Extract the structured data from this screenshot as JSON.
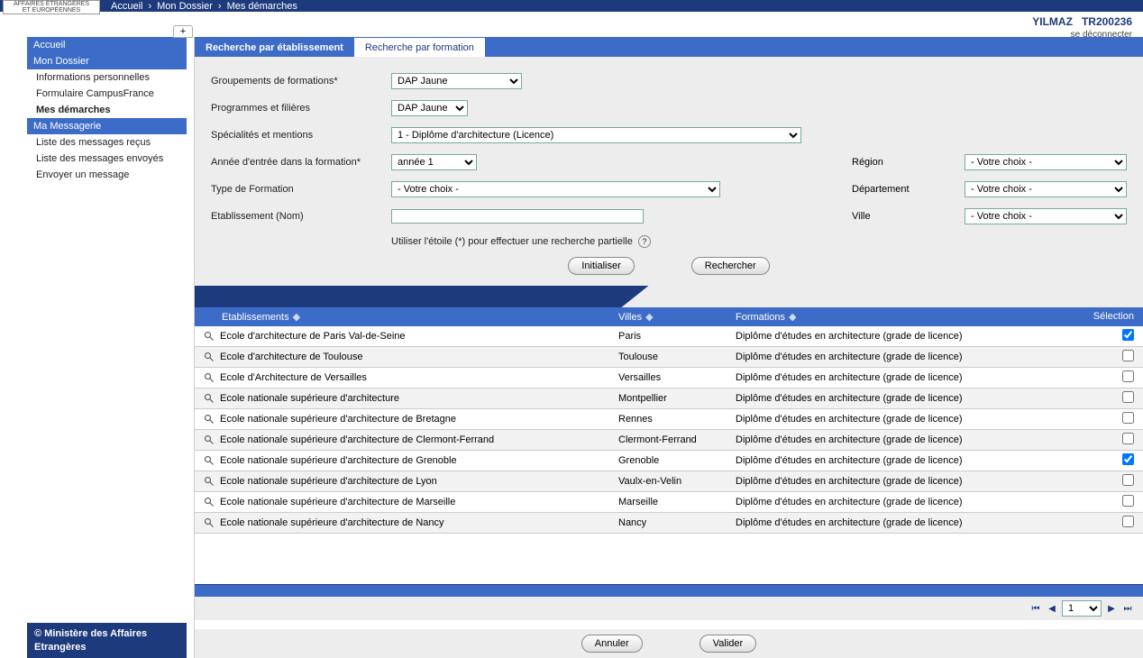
{
  "header": {
    "logo_line1": "AFFAIRES ÉTRANGÈRES",
    "logo_line2": "ET EUROPÉENNES",
    "breadcrumb": [
      "Accueil",
      "Mon Dossier",
      "Mes démarches"
    ],
    "user_name": "YILMAZ",
    "user_id": "TR200236",
    "logout": "se déconnecter",
    "plus": "+"
  },
  "sidebar": {
    "groups": [
      {
        "header": "Accueil",
        "items": []
      },
      {
        "header": "Mon Dossier",
        "items": [
          {
            "label": "Informations personnelles",
            "bold": false
          },
          {
            "label": "Formulaire CampusFrance",
            "bold": false
          },
          {
            "label": "Mes démarches",
            "bold": true
          }
        ]
      },
      {
        "header": "Ma Messagerie",
        "items": [
          {
            "label": "Liste des messages reçus",
            "bold": false
          },
          {
            "label": "Liste des messages envoyés",
            "bold": false
          },
          {
            "label": "Envoyer un message",
            "bold": false
          }
        ]
      }
    ],
    "footer": "© Ministère des Affaires Etrangères"
  },
  "tabs": {
    "active": "Recherche par établissement",
    "other": "Recherche par formation"
  },
  "form": {
    "lbl_groupements": "Groupements de formations*",
    "lbl_programmes": "Programmes et filières",
    "lbl_specialites": "Spécialités et mentions",
    "lbl_annee": "Année d'entrée dans la formation*",
    "lbl_type": "Type de Formation",
    "lbl_etablissement": "Etablissement (Nom)",
    "lbl_region": "Région",
    "lbl_departement": "Département",
    "lbl_ville": "Ville",
    "val_groupements": "DAP Jaune",
    "val_programmes": "DAP Jaune",
    "val_specialites": "1 - Diplôme d'architecture (Licence)",
    "val_annee": "année 1",
    "val_type": "- Votre choix -",
    "val_region": "- Votre choix -",
    "val_departement": "- Votre choix -",
    "val_ville": "- Votre choix -",
    "val_etablissement": "",
    "hint": "Utiliser l'étoile (*) pour effectuer une recherche partielle",
    "btn_init": "Initialiser",
    "btn_search": "Rechercher"
  },
  "table": {
    "headers": {
      "etab": "Etablissements",
      "ville": "Villes",
      "form": "Formations",
      "sel": "Sélection"
    },
    "rows": [
      {
        "etab": "Ecole d'architecture de Paris Val-de-Seine",
        "ville": "Paris",
        "form": "Diplôme d'études en architecture (grade de licence)",
        "sel": true
      },
      {
        "etab": "Ecole d'architecture de Toulouse",
        "ville": "Toulouse",
        "form": "Diplôme d'études en architecture (grade de licence)",
        "sel": false
      },
      {
        "etab": "Ecole d'Architecture de Versailles",
        "ville": "Versailles",
        "form": "Diplôme d'études en architecture (grade de licence)",
        "sel": false
      },
      {
        "etab": "Ecole nationale supérieure d'architecture",
        "ville": "Montpellier",
        "form": "Diplôme d'études en architecture (grade de licence)",
        "sel": false
      },
      {
        "etab": "Ecole nationale supérieure d'architecture de Bretagne",
        "ville": "Rennes",
        "form": "Diplôme d'études en architecture (grade de licence)",
        "sel": false
      },
      {
        "etab": "Ecole nationale supérieure d'architecture de Clermont-Ferrand",
        "ville": "Clermont-Ferrand",
        "form": "Diplôme d'études en architecture (grade de licence)",
        "sel": false
      },
      {
        "etab": "Ecole nationale supérieure d'architecture de Grenoble",
        "ville": "Grenoble",
        "form": "Diplôme d'études en architecture (grade de licence)",
        "sel": true
      },
      {
        "etab": "Ecole nationale supérieure d'architecture de Lyon",
        "ville": "Vaulx-en-Velin",
        "form": "Diplôme d'études en architecture (grade de licence)",
        "sel": false
      },
      {
        "etab": "Ecole nationale supérieure d'architecture de Marseille",
        "ville": "Marseille",
        "form": "Diplôme d'études en architecture (grade de licence)",
        "sel": false
      },
      {
        "etab": "Ecole nationale supérieure d'architecture de Nancy",
        "ville": "Nancy",
        "form": "Diplôme d'études en architecture (grade de licence)",
        "sel": false
      }
    ]
  },
  "pager": {
    "page": "1"
  },
  "footer_buttons": {
    "cancel": "Annuler",
    "validate": "Valider"
  }
}
